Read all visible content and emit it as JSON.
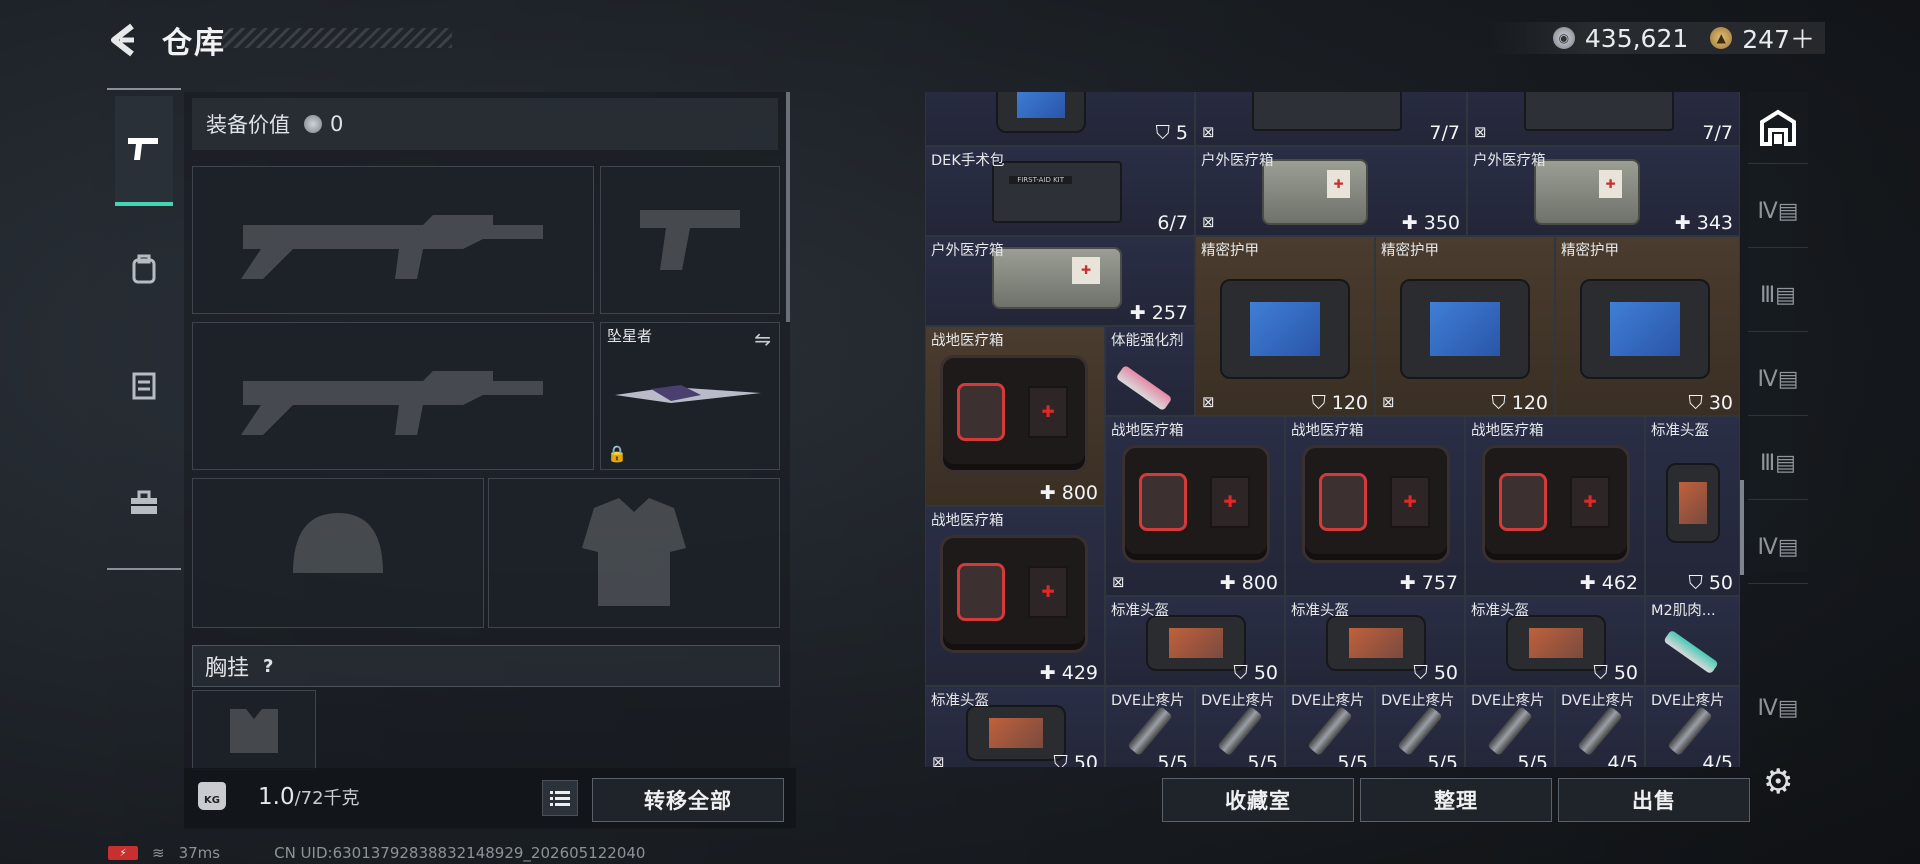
{
  "header": {
    "title": "仓库",
    "currency": [
      {
        "icon": "silver-coin-icon",
        "value": "435,621"
      },
      {
        "icon": "gold-coin-icon",
        "value": "247＋"
      }
    ]
  },
  "left_rail": {
    "tabs": [
      {
        "icon": "pistol-icon",
        "active": true
      },
      {
        "icon": "backpack-icon",
        "active": false
      },
      {
        "icon": "clipboard-icon",
        "active": false
      },
      {
        "icon": "toolbox-icon",
        "active": false
      }
    ]
  },
  "equipment": {
    "value_label": "装备价值",
    "value": "0",
    "melee_name": "坠星者",
    "chest_rig_label": "胸挂",
    "chest_rig_help": "?",
    "weight": "1.0",
    "weight_max": "/72千克",
    "kg_label": "KG",
    "transfer_all": "转移全部"
  },
  "inventory": {
    "cells": [
      {
        "name": "",
        "value": "5",
        "icon": "shield-icon"
      },
      {
        "name": "",
        "value": "7/7",
        "icon": "no-box-icon"
      },
      {
        "name": "",
        "value": "7/7",
        "icon": "no-box-icon"
      },
      {
        "name": "DEK手术包",
        "value": "6/7"
      },
      {
        "name": "户外医疗箱",
        "value": "350",
        "icon": "no-box-icon",
        "plus": true
      },
      {
        "name": "户外医疗箱",
        "value": "343",
        "plus": true
      },
      {
        "name": "户外医疗箱",
        "value": "257",
        "plus": true
      },
      {
        "name": "精密护甲",
        "value": "120",
        "icon": "no-box-icon"
      },
      {
        "name": "精密护甲",
        "value": "120",
        "icon": "no-box-icon"
      },
      {
        "name": "精密护甲",
        "value": "30"
      },
      {
        "name": "战地医疗箱",
        "value": "800",
        "plus": true
      },
      {
        "name": "体能强化剂",
        "value": ""
      },
      {
        "name": "战地医疗箱",
        "value": "800",
        "icon": "no-box-icon",
        "plus": true
      },
      {
        "name": "战地医疗箱",
        "value": "757",
        "plus": true
      },
      {
        "name": "战地医疗箱",
        "value": "462",
        "plus": true
      },
      {
        "name": "标准头盔",
        "value": "50"
      },
      {
        "name": "战地医疗箱",
        "value": "429",
        "plus": true
      },
      {
        "name": "标准头盔",
        "value": "50"
      },
      {
        "name": "标准头盔",
        "value": "50"
      },
      {
        "name": "标准头盔",
        "value": "50"
      },
      {
        "name": "M2肌肉...",
        "value": ""
      },
      {
        "name": "标准头盔",
        "value": "50",
        "icon": "no-box-icon"
      },
      {
        "name": "DVE止疼片",
        "value": "5/5"
      },
      {
        "name": "DVE止疼片",
        "value": "5/5"
      },
      {
        "name": "DVE止疼片",
        "value": "5/5"
      },
      {
        "name": "DVE止疼片",
        "value": "5/5"
      },
      {
        "name": "DVE止疼片",
        "value": "5/5"
      },
      {
        "name": "DVE止疼片",
        "value": "4/5"
      },
      {
        "name": "DVE止疼片",
        "value": "4/5"
      }
    ],
    "first_aid_text": "FIRST AID",
    "surgery_text": "FIRST-AID KIT"
  },
  "right_rail": {
    "items": [
      {
        "icon": "warehouse-icon",
        "active": true
      },
      {
        "icon": "box-iv-icon"
      },
      {
        "icon": "box-iii-icon"
      },
      {
        "icon": "box-iv-icon"
      },
      {
        "icon": "box-iii-icon"
      },
      {
        "icon": "box-iv-icon"
      },
      {
        "icon": "box-iv-icon"
      }
    ]
  },
  "bottom_buttons": {
    "collection": "收藏室",
    "organize": "整理",
    "sell": "出售"
  },
  "status": {
    "ping": "37ms",
    "uid": "CN UID:630137928388321489​29_202605122040"
  },
  "colors": {
    "accent": "#45d4b4",
    "cell_blue": "#2a2e46",
    "cell_brown": "#4a3c2e",
    "cell_gray": "#2c3036"
  }
}
